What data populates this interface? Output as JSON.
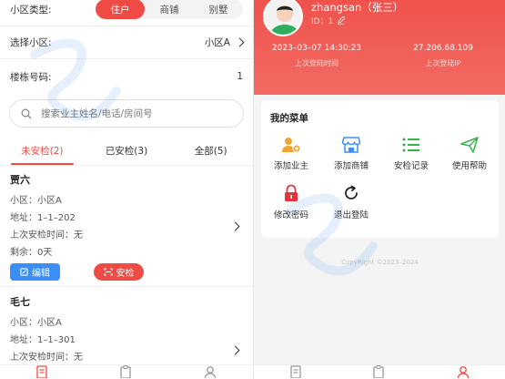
{
  "left": {
    "type_label": "小区类型:",
    "type_options": [
      "住户",
      "商铺",
      "别墅"
    ],
    "type_selected": 0,
    "community_label": "选择小区:",
    "community_value": "小区A",
    "building_label": "楼栋号码:",
    "building_value": "1",
    "search_placeholder": "搜索业主姓名/电话/房间号",
    "tabs": [
      "未安检(2)",
      "已安检(3)",
      "全部(5)"
    ],
    "tab_active": 0,
    "records": [
      {
        "name": "贾六",
        "community": "小区：小区A",
        "address": "地址：1–1–202",
        "last_check": "上次安检时间：无",
        "remaining": "剩余：0天",
        "edit_label": "编辑",
        "check_label": "安检"
      },
      {
        "name": "毛七",
        "community": "小区：小区A",
        "address": "地址：1–1–301",
        "last_check": "上次安检时间：无"
      }
    ]
  },
  "right": {
    "username": "zhangsan（张三）",
    "user_id": "ID：1",
    "last_login_time": "2023–03–07 14:30:23",
    "last_login_time_label": "上次登陆时间",
    "last_login_ip": "27.206.68.109",
    "last_login_ip_label": "上次登陆IP",
    "menu_title": "我的菜单",
    "menu_items": [
      {
        "label": "添加业主",
        "icon": "add-owner-icon"
      },
      {
        "label": "添加商铺",
        "icon": "shop-icon"
      },
      {
        "label": "安检记录",
        "icon": "list-icon"
      },
      {
        "label": "使用帮助",
        "icon": "send-icon"
      },
      {
        "label": "修改密码",
        "icon": "lock-icon"
      },
      {
        "label": "退出登陆",
        "icon": "refresh-icon"
      }
    ],
    "copyright": "CopyRight ©2023–2024"
  },
  "colors": {
    "accent": "#ef4a43",
    "blue": "#3a8ef6",
    "green": "#35b34a"
  }
}
